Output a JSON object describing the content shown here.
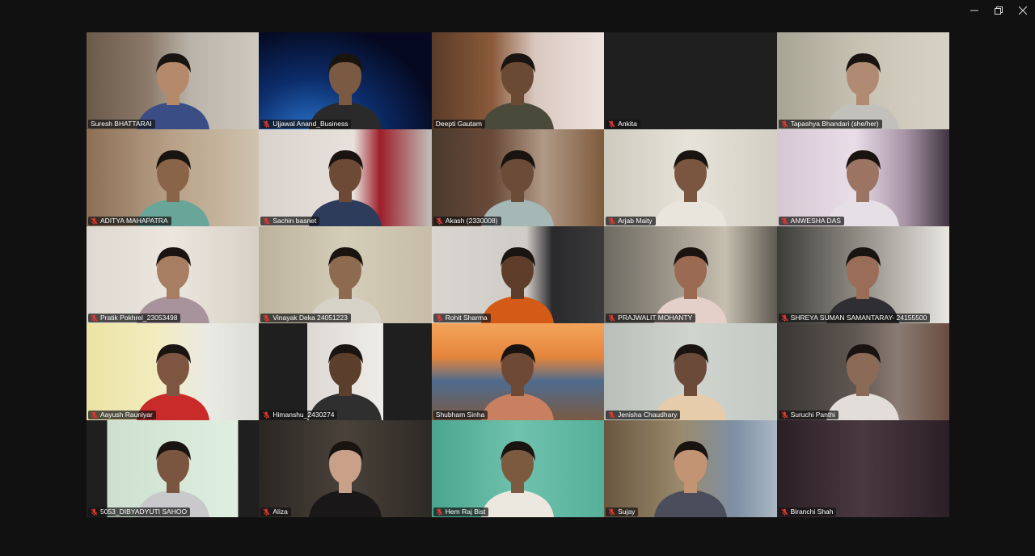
{
  "window": {
    "minimize_icon": "minimize-icon",
    "restore_icon": "restore-icon",
    "close_icon": "close-icon"
  },
  "colors": {
    "active_speaker_border": "#2ecc71",
    "muted_mic": "#e53935",
    "background": "#111111"
  },
  "participants": [
    {
      "name": "Suresh BHATTARAI",
      "muted": false,
      "active": true,
      "video": "on"
    },
    {
      "name": "Ujjawal Anand_Business",
      "muted": true,
      "active": false,
      "video": "on"
    },
    {
      "name": "Deepti Gautam",
      "muted": false,
      "active": false,
      "video": "on"
    },
    {
      "name": "Ankita",
      "muted": true,
      "active": false,
      "video": "off"
    },
    {
      "name": "Tapashya Bhandari (she/her)",
      "muted": true,
      "active": false,
      "video": "on"
    },
    {
      "name": "ADITYA MAHAPATRA",
      "muted": true,
      "active": false,
      "video": "on"
    },
    {
      "name": "Sachin basnet",
      "muted": true,
      "active": false,
      "video": "on"
    },
    {
      "name": "Akash (2330008)",
      "muted": true,
      "active": false,
      "video": "on"
    },
    {
      "name": "Arjab Maity",
      "muted": true,
      "active": false,
      "video": "on"
    },
    {
      "name": "ANWESHA DAS",
      "muted": true,
      "active": false,
      "video": "on"
    },
    {
      "name": "Pratik Pokhrel_23053498",
      "muted": true,
      "active": false,
      "video": "on"
    },
    {
      "name": "Vinayak Deka 24051223",
      "muted": true,
      "active": false,
      "video": "on"
    },
    {
      "name": "Rohit Sharma",
      "muted": true,
      "active": false,
      "video": "on"
    },
    {
      "name": "PRAJWALIT MOHANTY",
      "muted": true,
      "active": false,
      "video": "on"
    },
    {
      "name": "SHREYA SUMAN SAMANTARAY- 24155500",
      "muted": true,
      "active": false,
      "video": "on"
    },
    {
      "name": "Aayush Rauniyar",
      "muted": true,
      "active": false,
      "video": "on"
    },
    {
      "name": "Himanshu_2430274",
      "muted": true,
      "active": false,
      "video": "on"
    },
    {
      "name": "Shubham Sinha",
      "muted": false,
      "active": false,
      "video": "on"
    },
    {
      "name": "Jenisha Chaudhary",
      "muted": true,
      "active": false,
      "video": "on"
    },
    {
      "name": "Suruchi Panthi",
      "muted": true,
      "active": false,
      "video": "on"
    },
    {
      "name": "5053_DIBYADYUTI SAHOO",
      "muted": true,
      "active": false,
      "video": "on"
    },
    {
      "name": "Aliza",
      "muted": true,
      "active": false,
      "video": "on"
    },
    {
      "name": "Hem Raj Bist",
      "muted": true,
      "active": false,
      "video": "on"
    },
    {
      "name": "Sujay",
      "muted": true,
      "active": false,
      "video": "on"
    },
    {
      "name": "Biranchi Shah",
      "muted": true,
      "active": false,
      "video": "on"
    }
  ]
}
